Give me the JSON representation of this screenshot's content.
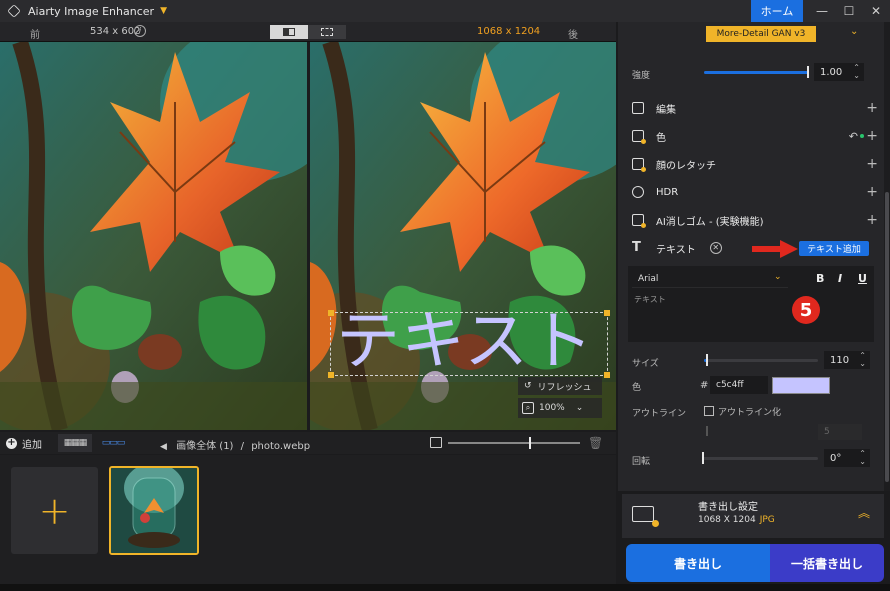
{
  "app": {
    "title": "Aiarty Image Enhancer",
    "home_label": "ホーム"
  },
  "compare": {
    "before_label": "前",
    "before_size": "534 x 602",
    "after_size": "1068 x 1204",
    "after_label": "後"
  },
  "preview": {
    "overlay_text": "テキスト",
    "refresh_label": "リフレッシュ",
    "zoom_level": "100%"
  },
  "bottom_bar": {
    "add_label": "追加",
    "breadcrumb_all": "画像全体 (1)",
    "breadcrumb_sep": "/",
    "file_name": "photo.webp"
  },
  "panel": {
    "model_name": "More-Detail GAN  v3",
    "strength_label": "強度",
    "strength_value": "1.00",
    "sections": [
      {
        "label": "編集"
      },
      {
        "label": "色"
      },
      {
        "label": "顔のレタッチ"
      },
      {
        "label": "HDR"
      },
      {
        "label": "AI消しゴム - (実験機能)"
      },
      {
        "label": "テキスト"
      }
    ],
    "add_text_button": "テキスト追加",
    "font_name": "Arial",
    "bold": "B",
    "italic": "I",
    "underline": "U",
    "text_placeholder": "テキスト",
    "step_badge": "5",
    "size_label": "サイズ",
    "size_value": "110",
    "color_label": "色",
    "color_hash": "#",
    "color_hex": "c5c4ff",
    "outline_label": "アウトライン",
    "outline_checkbox_label": "アウトライン化",
    "outline_value": "5",
    "rotation_label": "回転",
    "rotation_value": "0°"
  },
  "export": {
    "settings_title": "書き出し設定",
    "settings_size": "1068 X 1204",
    "settings_format": "JPG",
    "export_button": "書き出し",
    "batch_export_button": "一括書き出し"
  },
  "colors": {
    "accent_blue": "#1b6fe0",
    "accent_yellow": "#f0b429",
    "text_color": "#c5c4ff",
    "batch_purple": "#3b3cc8"
  }
}
